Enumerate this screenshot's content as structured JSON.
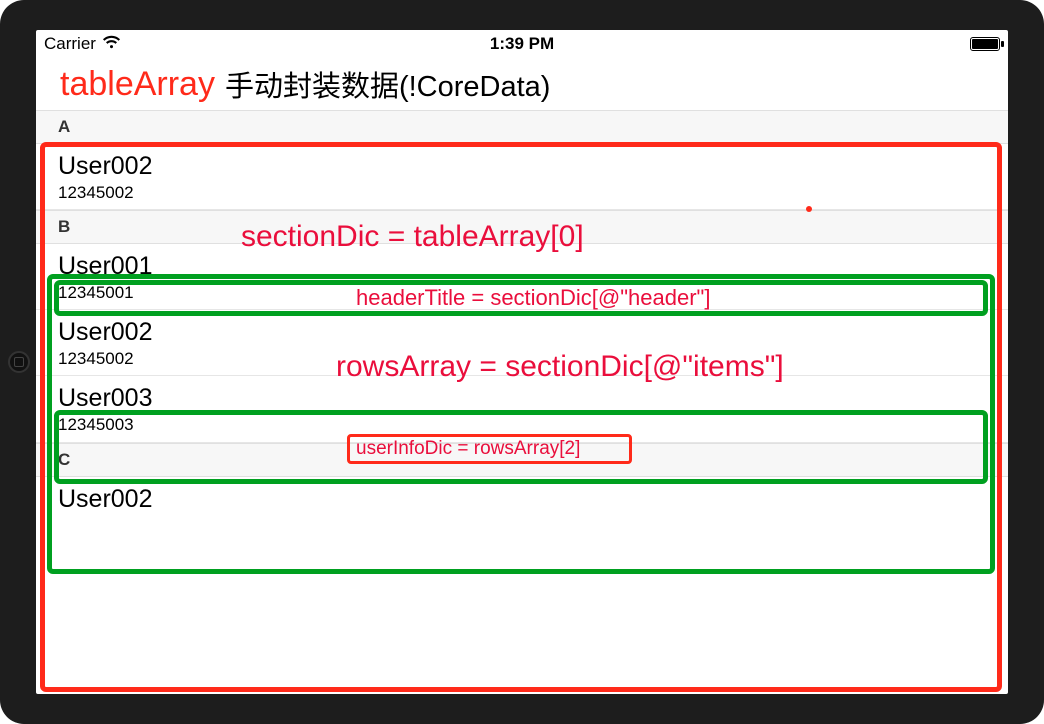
{
  "statusbar": {
    "carrier": "Carrier",
    "wifi_icon": "wifi-icon",
    "time": "1:39 PM"
  },
  "nav": {
    "tableArray_label": "tableArray",
    "title": "手动封装数据(!CoreData)"
  },
  "sections": [
    {
      "header": "A",
      "rows": [
        {
          "title": "User002",
          "subtitle": "12345002"
        }
      ]
    },
    {
      "header": "B",
      "rows": [
        {
          "title": "User001",
          "subtitle": "12345001"
        },
        {
          "title": "User002",
          "subtitle": "12345002"
        },
        {
          "title": "User003",
          "subtitle": "12345003"
        }
      ]
    },
    {
      "header": "C",
      "rows": [
        {
          "title": "User002",
          "subtitle": ""
        }
      ]
    }
  ],
  "annotations": {
    "sectionDic": "sectionDic = tableArray[0]",
    "headerTitle": "headerTitle = sectionDic[@\"header\"]",
    "rowsArray": "rowsArray = sectionDic[@\"items\"]",
    "userInfoDic": "userInfoDic = rowsArray[2]"
  }
}
